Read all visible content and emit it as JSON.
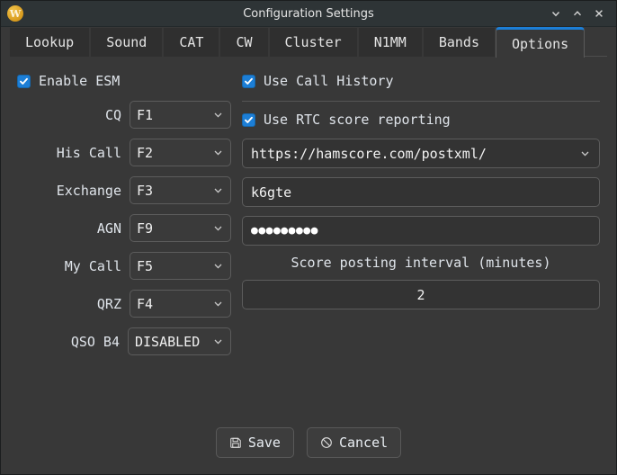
{
  "window": {
    "title": "Configuration Settings",
    "app_icon": "w-logo-icon",
    "controls": [
      {
        "name": "minimize-button",
        "icon": "chevron-down-icon"
      },
      {
        "name": "maximize-button",
        "icon": "chevron-up-icon"
      },
      {
        "name": "close-button",
        "icon": "close-icon"
      }
    ]
  },
  "tabs": [
    {
      "label": "Lookup",
      "active": false
    },
    {
      "label": "Sound",
      "active": false
    },
    {
      "label": "CAT",
      "active": false
    },
    {
      "label": "CW",
      "active": false
    },
    {
      "label": "Cluster",
      "active": false
    },
    {
      "label": "N1MM",
      "active": false
    },
    {
      "label": "Bands",
      "active": false
    },
    {
      "label": "Options",
      "active": true
    }
  ],
  "left": {
    "enable_esm": {
      "label": "Enable ESM",
      "checked": true
    },
    "fields": [
      {
        "label": "CQ",
        "value": "F1"
      },
      {
        "label": "His Call",
        "value": "F2"
      },
      {
        "label": "Exchange",
        "value": "F3"
      },
      {
        "label": "AGN",
        "value": "F9"
      },
      {
        "label": "My Call",
        "value": "F5"
      },
      {
        "label": "QRZ",
        "value": "F4"
      },
      {
        "label": "QSO B4",
        "value": "DISABLED"
      }
    ]
  },
  "right": {
    "use_call_history": {
      "label": "Use Call History",
      "checked": true
    },
    "use_rtc_score_reporting": {
      "label": "Use RTC score reporting",
      "checked": true
    },
    "url": "https://hamscore.com/postxml/",
    "username": "k6gte",
    "password_masked": "●●●●●●●●●",
    "interval_label": "Score posting interval (minutes)",
    "interval_value": "2"
  },
  "footer": {
    "save": {
      "label": "Save",
      "icon": "floppy-disk-icon"
    },
    "cancel": {
      "label": "Cancel",
      "icon": "prohibited-icon"
    }
  },
  "colors": {
    "accent": "#1c7ed6",
    "window_bg": "#383838",
    "titlebar_bg": "#2e3436",
    "field_bg": "#333333",
    "border": "#5c5c5c",
    "app_icon": "#d89b1e"
  }
}
